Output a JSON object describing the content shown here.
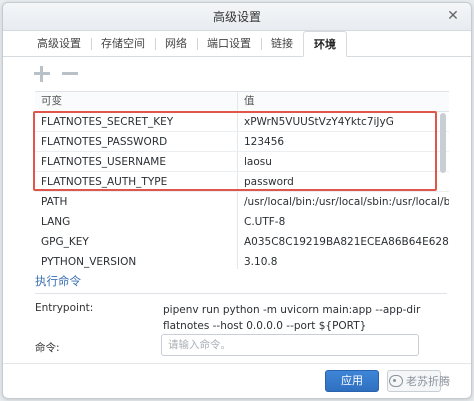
{
  "window": {
    "title": "高级设置"
  },
  "tabs": [
    {
      "label": "高级设置"
    },
    {
      "label": "存储空间"
    },
    {
      "label": "网络"
    },
    {
      "label": "端口设置"
    },
    {
      "label": "链接"
    },
    {
      "label": "环境"
    }
  ],
  "active_tab": "环境",
  "table": {
    "headers": [
      "可变",
      "值"
    ],
    "rows": [
      {
        "name": "FLATNOTES_SECRET_KEY",
        "value": "xPWrN5VUUStVzY4Yktc7iJyG"
      },
      {
        "name": "FLATNOTES_PASSWORD",
        "value": "123456"
      },
      {
        "name": "FLATNOTES_USERNAME",
        "value": "laosu"
      },
      {
        "name": "FLATNOTES_AUTH_TYPE",
        "value": "password"
      },
      {
        "name": "PATH",
        "value": "/usr/local/bin:/usr/local/sbin:/usr/local/bin:/usr"
      },
      {
        "name": "LANG",
        "value": "C.UTF-8"
      },
      {
        "name": "GPG_KEY",
        "value": "A035C8C19219BA821ECEA86B64E628F8D"
      },
      {
        "name": "PYTHON_VERSION",
        "value": "3.10.8"
      }
    ]
  },
  "execution": {
    "title": "执行命令",
    "entrypoint_label": "Entrypoint:",
    "entrypoint_value": "pipenv run python -m uvicorn main:app --app-dir flatnotes --host 0.0.0.0 --port ${PORT}",
    "command_label": "命令:",
    "command_placeholder": "请输入命令。"
  },
  "footer": {
    "apply_label": "应用",
    "watermark": "老苏折腾"
  },
  "colors": {
    "accent": "#2f6fc0",
    "highlight": "#e0564a",
    "section_title": "#3a6fb3"
  }
}
